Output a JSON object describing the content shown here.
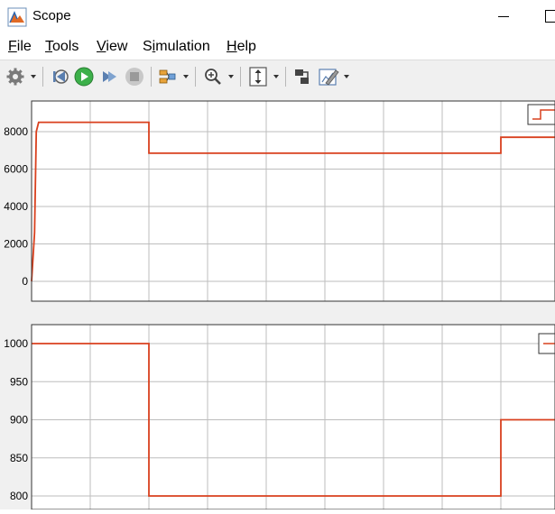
{
  "window": {
    "title": "Scope"
  },
  "menu": {
    "file": {
      "label": "File"
    },
    "tools": {
      "label": "Tools"
    },
    "view": {
      "label": "View"
    },
    "simulation": {
      "label": "Simulation"
    },
    "help": {
      "label": "Help"
    }
  },
  "toolbar": {
    "items": [
      "gear-icon",
      "step-back-icon",
      "run-icon",
      "step-forward-icon",
      "stop-icon",
      "signal-selector-icon",
      "zoom-icon",
      "autoscale-icon",
      "highlight-block-icon",
      "edit-style-icon"
    ]
  },
  "colors": {
    "trace": "#d9401e",
    "plot_bg": "#ffffff",
    "figure_bg": "#f0f0f0",
    "grid": "#bdbdbd"
  },
  "chart_data": [
    {
      "type": "line",
      "title": "",
      "xlabel": "",
      "ylabel": "",
      "ylim": [
        -500,
        9000
      ],
      "xlim": [
        0,
        9
      ],
      "grid": true,
      "legend": "top-right",
      "yticks": [
        0,
        2000,
        4000,
        6000,
        8000
      ],
      "ytick_labels": [
        "0",
        "2000",
        "4000",
        "6000",
        "8000"
      ],
      "series": [
        {
          "x": [
            0,
            0.05,
            0.08,
            0.12,
            2.0,
            2.0,
            8.0,
            8.0,
            9.0
          ],
          "y": [
            0,
            2600,
            8000,
            8500,
            8500,
            6850,
            6850,
            7700,
            7700
          ]
        }
      ]
    },
    {
      "type": "line",
      "title": "",
      "xlabel": "",
      "ylabel": "",
      "ylim": [
        790,
        1010
      ],
      "xlim": [
        0,
        9
      ],
      "grid": true,
      "legend": "top-right",
      "yticks": [
        800,
        850,
        900,
        950,
        1000
      ],
      "ytick_labels": [
        "800",
        "850",
        "900",
        "950",
        "1000"
      ],
      "series": [
        {
          "x": [
            0,
            2.0,
            2.0,
            8.0,
            8.0,
            9.0
          ],
          "y": [
            1000,
            1000,
            800,
            800,
            900,
            900
          ]
        }
      ]
    }
  ]
}
